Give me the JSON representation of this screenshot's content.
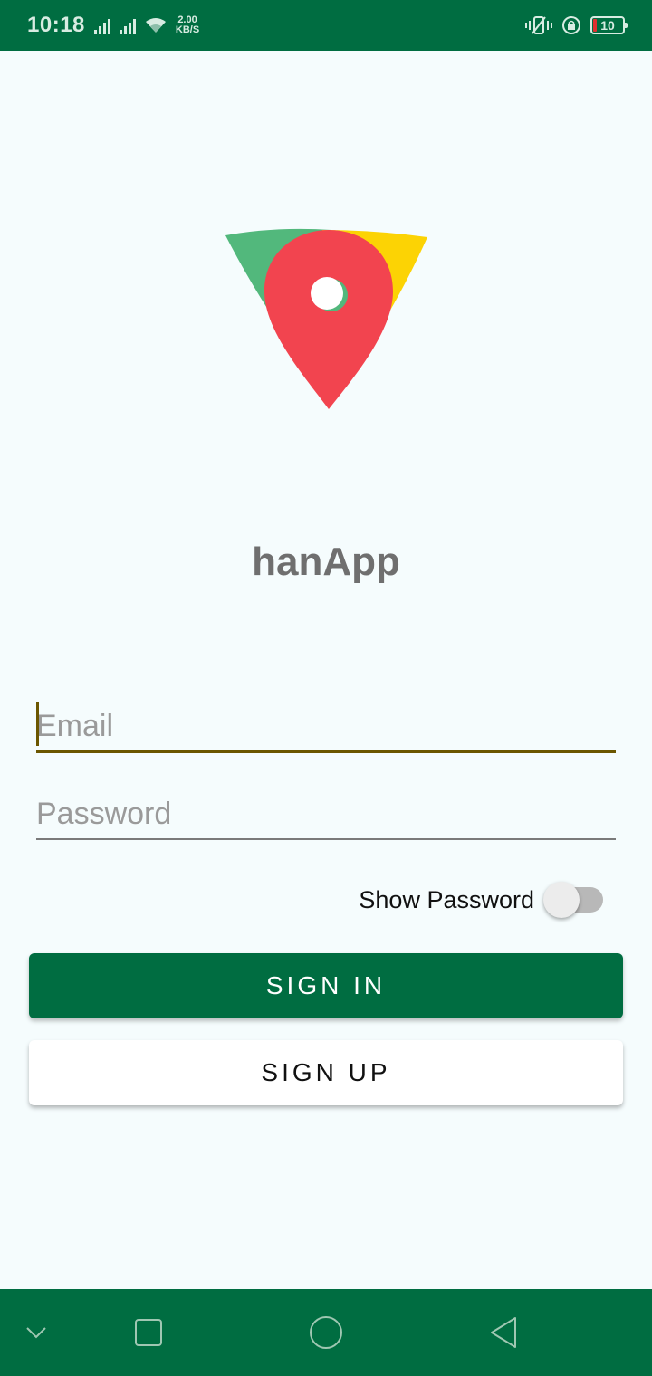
{
  "status_bar": {
    "time": "10:18",
    "net_speed_value": "2.00",
    "net_speed_unit": "KB/S",
    "battery_level": "10",
    "icons": [
      "signal-icon",
      "signal-icon",
      "wifi-icon",
      "vibrate-icon",
      "rotation-lock-icon",
      "battery-icon"
    ]
  },
  "app": {
    "logo": "map-pin-logo",
    "title": "hanApp"
  },
  "form": {
    "email_placeholder": "Email",
    "password_placeholder": "Password",
    "show_password_label": "Show Password",
    "show_password_on": false,
    "sign_in_label": "SIGN IN",
    "sign_up_label": "SIGN UP"
  },
  "nav_bar": {
    "icons": [
      "chevron-down-icon",
      "recents-icon",
      "home-icon",
      "back-icon"
    ]
  },
  "colors": {
    "primary": "#006d41",
    "background": "#f5fcfd",
    "logo_green": "#52b87c",
    "logo_yellow": "#fcd304",
    "logo_red": "#f2444f",
    "focus_underline": "#6b5600"
  }
}
